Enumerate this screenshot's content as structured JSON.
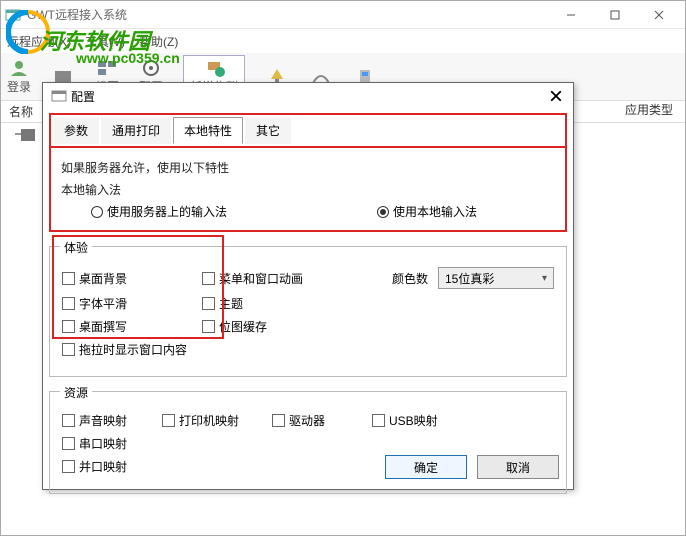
{
  "main": {
    "title": "GWT远程接入系统",
    "menus": [
      "远程应用(X)",
      "工具(V)",
      "帮助(Z)"
    ]
  },
  "watermark": {
    "brand": "河东软件园",
    "url": "www.pc0359.cn"
  },
  "toolbar": {
    "items": [
      "登录",
      "",
      "组图",
      "配置",
      "新增集群",
      "",
      "",
      ""
    ]
  },
  "columns": {
    "name": "名称",
    "apptype": "应用类型"
  },
  "dialog": {
    "title": "配置",
    "tabs": [
      "参数",
      "通用打印",
      "本地特性",
      "其它"
    ],
    "hint1": "如果服务器允许，使用以下特性",
    "ime_title": "本地输入法",
    "ime_server": "使用服务器上的输入法",
    "ime_local": "使用本地输入法",
    "exp_title": "体验",
    "cb_bg": "桌面背景",
    "cb_font": "字体平滑",
    "cb_compose": "桌面撰写",
    "cb_dragwin": "拖拉时显示窗口内容",
    "cb_menuanim": "菜单和窗口动画",
    "cb_theme": "主题",
    "cb_bmpcache": "位图缓存",
    "color_label": "颜色数",
    "color_value": "15位真彩",
    "res_title": "资源",
    "cb_audio": "声音映射",
    "cb_printer": "打印机映射",
    "cb_drive": "驱动器",
    "cb_usb": "USB映射",
    "cb_serial": "串口映射",
    "cb_parallel": "并口映射",
    "ok": "确定",
    "cancel": "取消"
  }
}
